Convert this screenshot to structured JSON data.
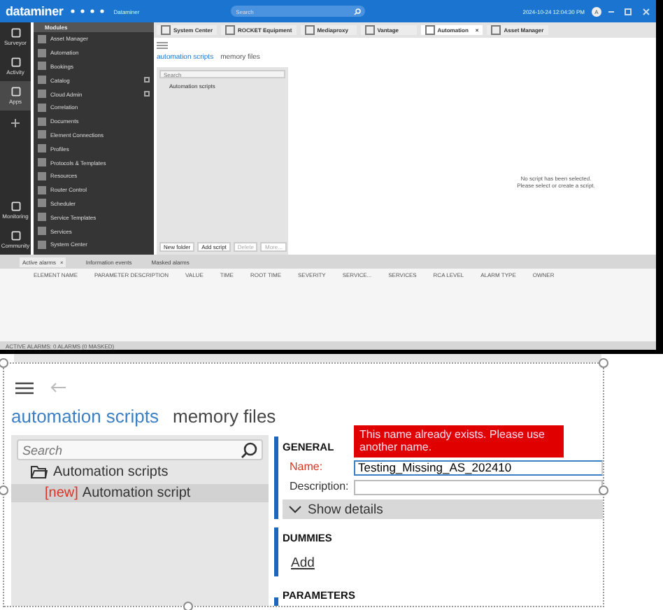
{
  "top": {
    "header": {
      "logo": "dataminer",
      "title": "Dataminer",
      "search_placeholder": "Search",
      "datetime": "2024-10-24 12:04:30 PM",
      "avatar": "A"
    },
    "rail": [
      {
        "label": "Surveyor",
        "selected": false
      },
      {
        "label": "Activity",
        "selected": false
      },
      {
        "label": "Apps",
        "selected": true
      },
      {
        "label": "Monitoring",
        "selected": false
      },
      {
        "label": "Community",
        "selected": false
      }
    ],
    "modules": {
      "title": "Modules",
      "items": [
        {
          "label": "Asset Manager",
          "pinned": false
        },
        {
          "label": "Automation",
          "pinned": false
        },
        {
          "label": "Bookings",
          "pinned": false
        },
        {
          "label": "Catalog",
          "pinned": true
        },
        {
          "label": "Cloud Admin",
          "pinned": true
        },
        {
          "label": "Correlation",
          "pinned": false
        },
        {
          "label": "Documents",
          "pinned": false
        },
        {
          "label": "Element Connections",
          "pinned": false
        },
        {
          "label": "Profiles",
          "pinned": false
        },
        {
          "label": "Protocols & Templates",
          "pinned": false
        },
        {
          "label": "Resources",
          "pinned": false
        },
        {
          "label": "Router Control",
          "pinned": false
        },
        {
          "label": "Scheduler",
          "pinned": false
        },
        {
          "label": "Service Templates",
          "pinned": false
        },
        {
          "label": "Services",
          "pinned": false
        },
        {
          "label": "System Center",
          "pinned": false
        }
      ]
    },
    "app_tabs": [
      {
        "label": "System Center",
        "selected": false
      },
      {
        "label": "ROCKET Equipment",
        "selected": false
      },
      {
        "label": "Mediaproxy",
        "selected": false
      },
      {
        "label": "Vantage",
        "selected": false
      },
      {
        "label": "Automation",
        "selected": true,
        "close": "×"
      },
      {
        "label": "Asset Manager",
        "selected": false
      }
    ],
    "script_tabs": [
      {
        "label": "automation scripts",
        "selected": true
      },
      {
        "label": "memory files",
        "selected": false
      }
    ],
    "search_placeholder": "Search",
    "tree": [
      {
        "label": "Automation scripts"
      }
    ],
    "buttons": [
      {
        "label": "New folder",
        "disabled": false
      },
      {
        "label": "Add script",
        "disabled": false
      },
      {
        "label": "Delete",
        "disabled": true
      },
      {
        "label": "More...",
        "disabled": true
      }
    ],
    "empty_message": [
      "No script has been selected.",
      "Please select or create a script."
    ],
    "alarm_tabs": [
      {
        "label": "Active alarms",
        "selected": true,
        "close": "×"
      },
      {
        "label": "Information events",
        "selected": false
      },
      {
        "label": "Masked alarms",
        "selected": false
      }
    ],
    "alarm_columns": [
      "ELEMENT NAME",
      "PARAMETER DESCRIPTION",
      "VALUE",
      "TIME",
      "ROOT TIME",
      "SEVERITY",
      "SERVICE...",
      "SERVICES",
      "RCA LEVEL",
      "ALARM TYPE",
      "OWNER"
    ],
    "status": "ACTIVE ALARMS: 0 ALARMS (0 MASKED)"
  },
  "detail": {
    "script_tabs": [
      {
        "label": "automation scripts",
        "selected": true
      },
      {
        "label": "memory files",
        "selected": false
      }
    ],
    "search_placeholder": "Search",
    "tree": [
      {
        "label": "Automation scripts",
        "kind": "folder",
        "selected": false
      },
      {
        "label": "Automation script",
        "kind": "script",
        "selected": true,
        "tag": "[new]"
      }
    ],
    "sections": [
      {
        "title": "GENERAL",
        "kind": "general"
      },
      {
        "title": "DUMMIES",
        "kind": "dummies",
        "link": "Add"
      },
      {
        "title": "PARAMETERS",
        "kind": "heading"
      }
    ],
    "name_label": "Name:",
    "name_value": "Testing_Missing_AS_202410",
    "name_error": true,
    "error_message": "This name already exists. Please use another name.",
    "description_label": "Description:",
    "show_details": {
      "label": "Show details",
      "expanded": false
    }
  }
}
